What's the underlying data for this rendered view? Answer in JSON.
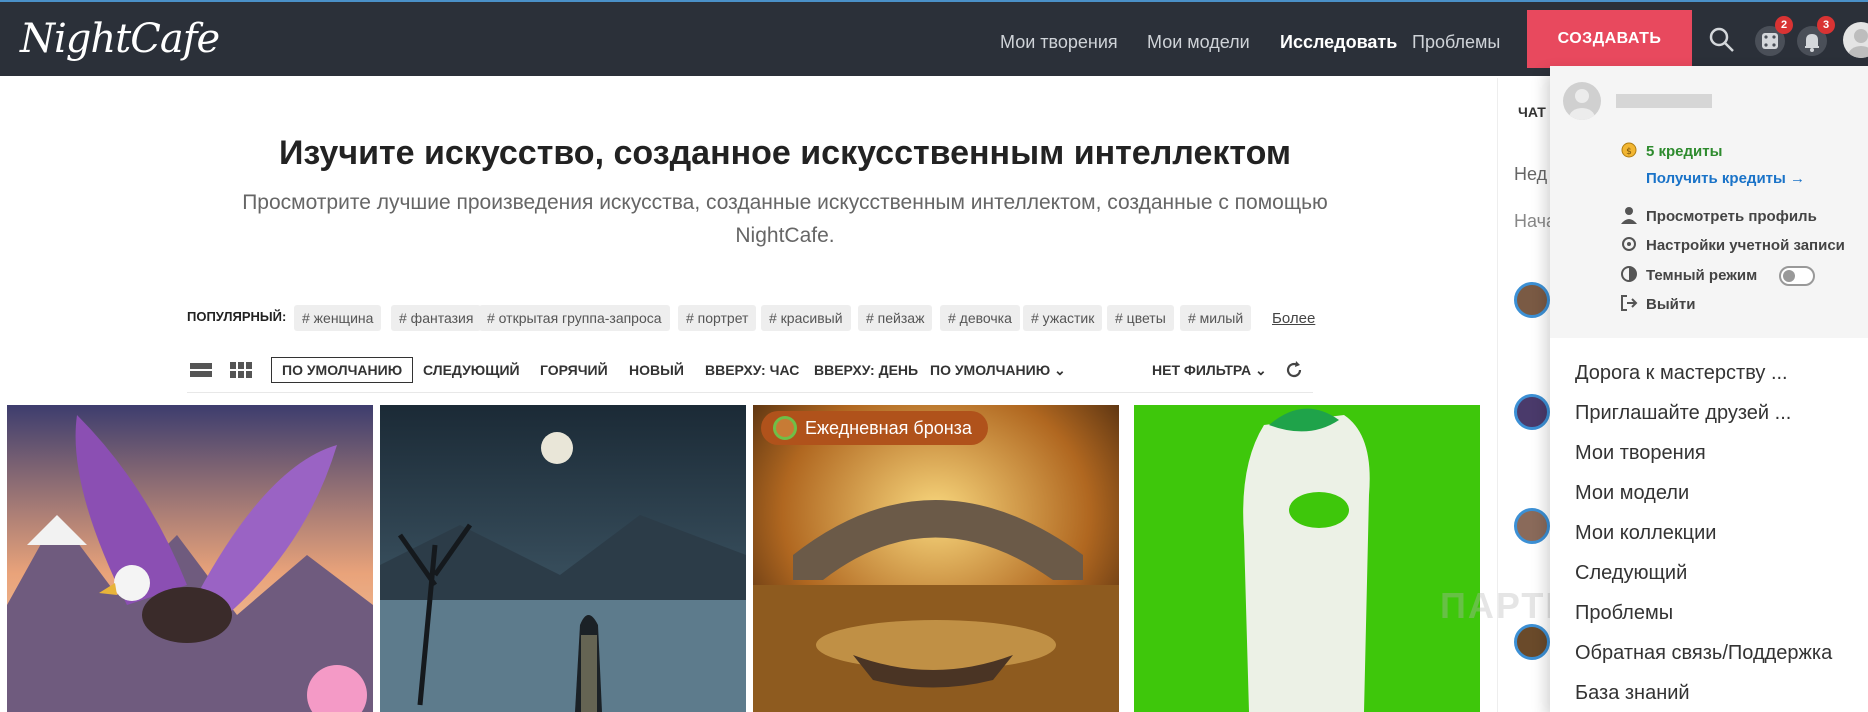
{
  "header": {
    "logo": "NightCafe",
    "nav": [
      "Мои творения",
      "Мои модели",
      "Исследовать",
      "Проблемы"
    ],
    "create_label": "СОЗДАВАТЬ",
    "dice_badge": "2",
    "bell_badge": "3"
  },
  "hero": {
    "title": "Изучите искусство, созданное искусственным интеллектом",
    "subtitle": "Просмотрите лучшие произведения искусства, созданные искусственным интеллектом, созданные с помощью NightCafe."
  },
  "popular": {
    "label": "ПОПУЛЯРНЫЙ:",
    "tags": [
      "# женщина",
      "# фантазия",
      "# открытая группа-запроса",
      "# портрет",
      "# красивый",
      "# пейзаж",
      "# девочка",
      "# ужастик",
      "# цветы",
      "# милый"
    ],
    "more": "Более"
  },
  "filters": {
    "items": [
      "ПО УМОЛЧАНИЮ",
      "СЛЕДУЮЩИЙ",
      "ГОРЯЧИЙ",
      "НОВЫЙ",
      "ВВЕРХУ: ЧАС",
      "ВВЕРХУ: ДЕНЬ",
      "ПО УМОЛЧАНИЮ ⌄"
    ],
    "no_filter": "НЕТ ФИЛЬТРА ⌄"
  },
  "gallery": {
    "award_label": "Ежедневная бронза"
  },
  "sidebar_peek": {
    "label": "ЧАТ",
    "field1": "Нед",
    "field2": "Нача"
  },
  "dropdown": {
    "credits": "5 кредиты",
    "get_credits": "Получить кредиты →",
    "view_profile": "Просмотреть профиль",
    "account_settings": "Настройки учетной записи",
    "dark_mode": "Темный режим",
    "logout": "Выйти",
    "items": [
      "Дорога к мастерству ...",
      "Приглашайте друзей ...",
      "Мои творения",
      "Мои модели",
      "Мои коллекции",
      "Следующий",
      "Проблемы",
      "Обратная связь/Поддержка",
      "База знаний"
    ]
  },
  "watermark": "ПАРТНЕРКИН",
  "colors": {
    "topbar": "#2b3039",
    "create": "#e8495e",
    "credits": "#2e8b2e",
    "link": "#1a73c8"
  }
}
